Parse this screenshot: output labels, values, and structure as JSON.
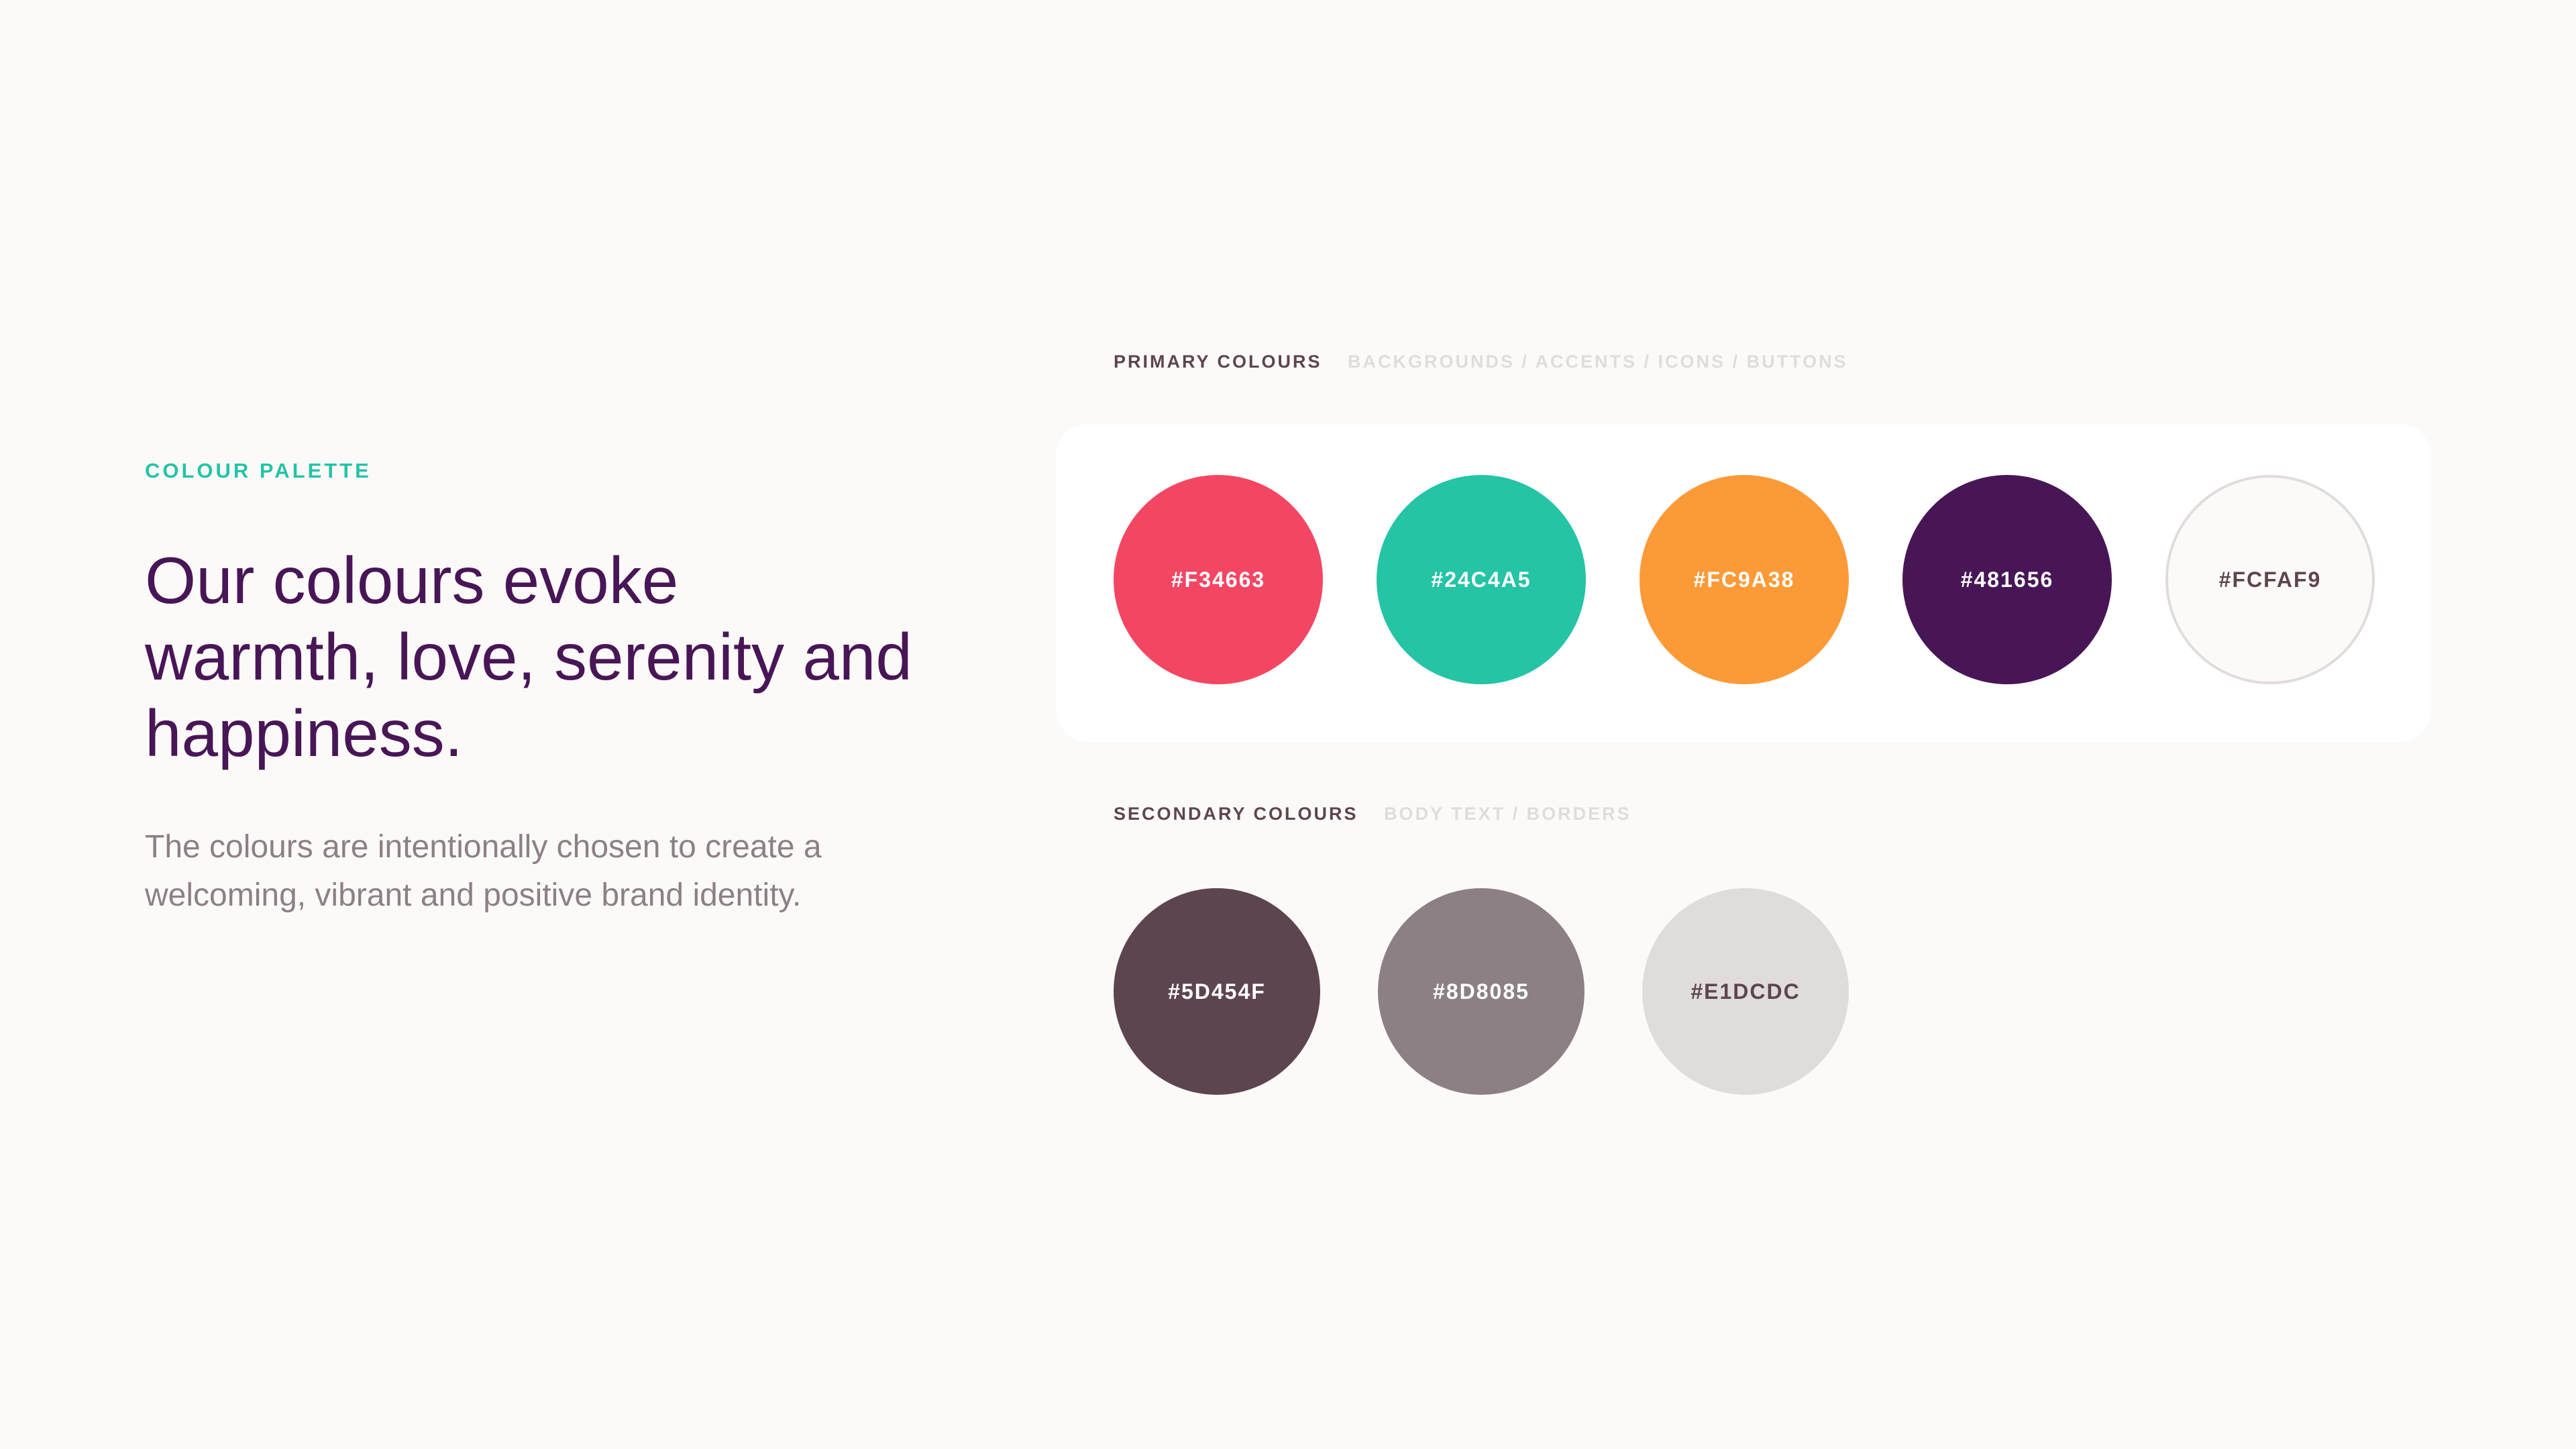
{
  "eyebrow": "COLOUR PALETTE",
  "headline": "Our colours evoke warmth, love, serenity and happiness.",
  "intro": "The colours are intentionally chosen to create a welcoming, vibrant and positive brand identity.",
  "primary": {
    "label": "PRIMARY COLOURS",
    "usage": "BACKGROUNDS / ACCENTS / ICONS / BUTTONS",
    "swatches": [
      {
        "hex": "#F34663",
        "color": "#F34663",
        "text_color": "#FFFFFF"
      },
      {
        "hex": "#24C4A5",
        "color": "#24C4A5",
        "text_color": "#FFFFFF"
      },
      {
        "hex": "#FC9A38",
        "color": "#FC9A38",
        "text_color": "#FFFFFF"
      },
      {
        "hex": "#481656",
        "color": "#481656",
        "text_color": "#FFFFFF"
      },
      {
        "hex": "#FCFAF9",
        "color": "#FCFAF9",
        "text_color": "#5D454F"
      }
    ]
  },
  "secondary": {
    "label": "SECONDARY COLOURS",
    "usage": "BODY TEXT / BORDERS",
    "swatches": [
      {
        "hex": "#5D454F",
        "color": "#5D454F",
        "text_color": "#FFFFFF"
      },
      {
        "hex": "#8D8085",
        "color": "#8D8085",
        "text_color": "#FFFFFF"
      },
      {
        "hex": "#E1DCDC",
        "color": "#E1DCDC",
        "text_color": "#5D454F"
      }
    ]
  },
  "theme": {
    "background": "#FCFAF9",
    "card": "#FFFFFF",
    "accent": "#24C4A5",
    "heading": "#481656",
    "body": "#8D8085",
    "label": "#5D454F",
    "label_muted": "#E1DCDC",
    "light_swatch_border": "#E1DCDC"
  }
}
